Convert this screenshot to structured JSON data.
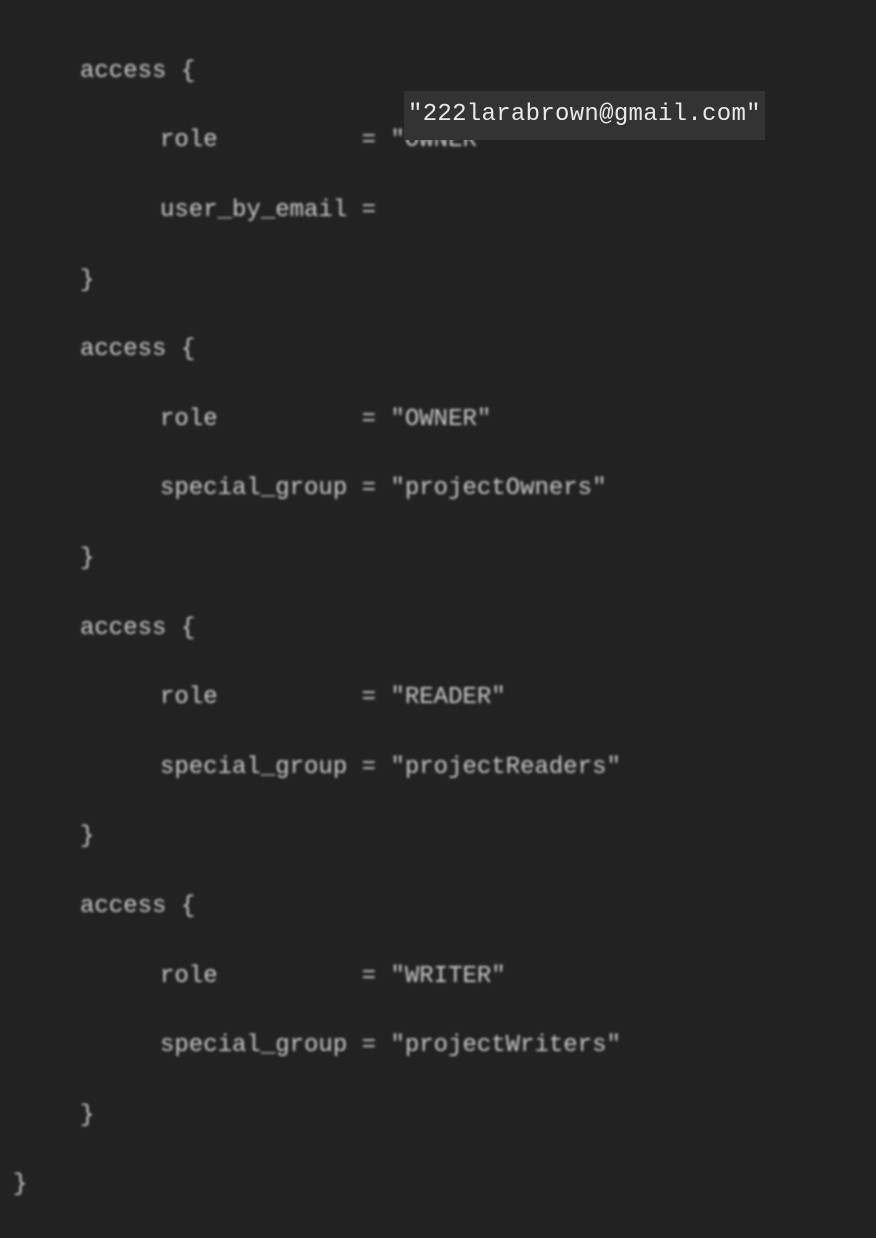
{
  "code": {
    "blocks": [
      {
        "open": "access {",
        "lines": [
          {
            "key": "role",
            "padded_key": "role         ",
            "eq": " = ",
            "value": "\"OWNER\""
          },
          {
            "key": "user_by_email",
            "padded_key": "user_by_email",
            "eq": " = ",
            "value": ""
          }
        ],
        "close": "}"
      },
      {
        "open": "access {",
        "lines": [
          {
            "key": "role",
            "padded_key": "role         ",
            "eq": " = ",
            "value": "\"OWNER\""
          },
          {
            "key": "special_group",
            "padded_key": "special_group",
            "eq": " = ",
            "value": "\"projectOwners\""
          }
        ],
        "close": "}"
      },
      {
        "open": "access {",
        "lines": [
          {
            "key": "role",
            "padded_key": "role         ",
            "eq": " = ",
            "value": "\"READER\""
          },
          {
            "key": "special_group",
            "padded_key": "special_group",
            "eq": " = ",
            "value": "\"projectReaders\""
          }
        ],
        "close": "}"
      },
      {
        "open": "access {",
        "lines": [
          {
            "key": "role",
            "padded_key": "role         ",
            "eq": " = ",
            "value": "\"WRITER\""
          },
          {
            "key": "special_group",
            "padded_key": "special_group",
            "eq": " = ",
            "value": "\"projectWriters\""
          }
        ],
        "close": "}"
      }
    ],
    "outer_close": "}"
  },
  "overlay": {
    "email": "\"222larabrown@gmail.com\""
  }
}
